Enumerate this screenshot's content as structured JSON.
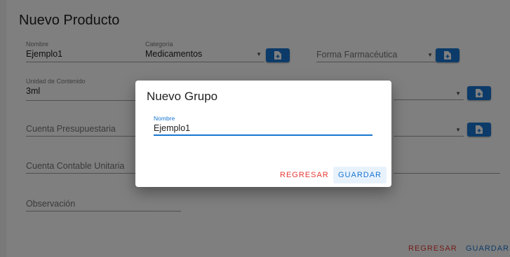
{
  "form": {
    "title": "Nuevo Producto",
    "nombre": {
      "label": "Nombre",
      "value": "Ejemplo1"
    },
    "categoria": {
      "label": "Categoría",
      "value": "Medicamentos"
    },
    "forma": {
      "placeholder": "Forma Farmacéutica"
    },
    "unidad": {
      "label": "Unidad de Contenido",
      "value": "3ml"
    },
    "cuenta_presupuestaria": {
      "placeholder": "Cuenta Presupuestaria"
    },
    "cuenta_contable": {
      "placeholder": "Cuenta Contable Unitaria"
    },
    "observacion": {
      "placeholder": "Observación"
    },
    "footer": {
      "back_label": "REGRESAR",
      "save_label": "GUARDAR"
    }
  },
  "dialog": {
    "title": "Nuevo Grupo",
    "nombre": {
      "label": "Nombre",
      "value": "Ejemplo1"
    },
    "back_label": "REGRESAR",
    "save_label": "GUARDAR"
  },
  "colors": {
    "primary": "#1976d2",
    "danger": "#e53935",
    "overlay": "rgba(0,0,0,0.5)"
  },
  "icons": {
    "add_button": "add-document-icon",
    "dropdown": "caret-down-icon"
  }
}
